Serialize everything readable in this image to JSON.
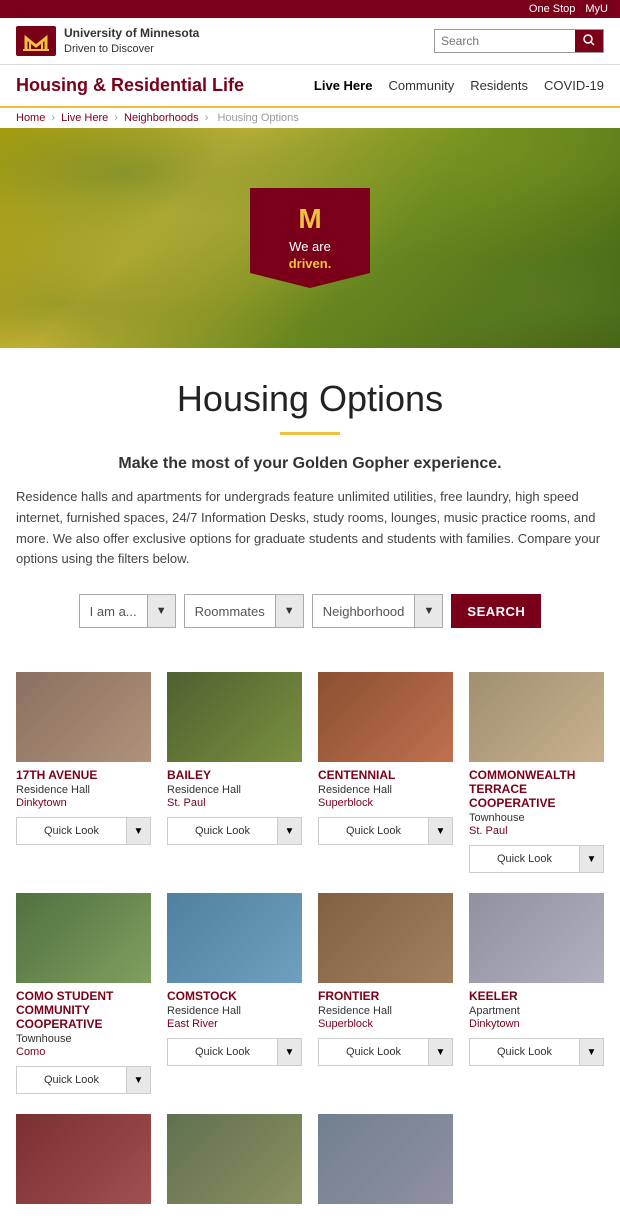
{
  "topbar": {
    "one_stop": "One Stop",
    "myu": "MyU"
  },
  "logo": {
    "line1": "University of Minnesota",
    "line2": "Driven to Discover"
  },
  "search": {
    "placeholder": "Search"
  },
  "nav": {
    "brand": "Housing & Residential Life",
    "links": [
      {
        "label": "Live Here",
        "active": true
      },
      {
        "label": "Community",
        "active": false
      },
      {
        "label": "Residents",
        "active": false
      },
      {
        "label": "COVID-19",
        "active": false
      }
    ]
  },
  "breadcrumb": {
    "items": [
      "Home",
      "Live Here",
      "Neighborhoods",
      "Housing Options"
    ]
  },
  "hero": {
    "flag_m": "M",
    "flag_line1": "We are",
    "flag_line2": "driven."
  },
  "page": {
    "title": "Housing Options",
    "subtitle": "Make the most of your Golden Gopher experience.",
    "description": "Residence halls and apartments for undergrads feature unlimited utilities, free laundry, high speed internet, furnished spaces, 24/7 Information Desks, study rooms, lounges, music practice rooms, and more. We also offer exclusive options for graduate students and students with families. Compare your options using the filters below."
  },
  "filters": {
    "role_placeholder": "I am a...",
    "roommates_placeholder": "Roommates",
    "neighborhood_placeholder": "Neighborhood",
    "search_label": "SEARCH"
  },
  "housing": [
    {
      "name": "17TH AVENUE",
      "type": "Residence Hall",
      "neighborhood": "Dinkytown",
      "img_class": "img-17th",
      "quick_look": "Quick Look"
    },
    {
      "name": "BAILEY",
      "type": "Residence Hall",
      "neighborhood": "St. Paul",
      "img_class": "img-bailey",
      "quick_look": "Quick Look"
    },
    {
      "name": "CENTENNIAL",
      "type": "Residence Hall",
      "neighborhood": "Superblock",
      "img_class": "img-centennial",
      "quick_look": "Quick Look"
    },
    {
      "name": "COMMONWEALTH TERRACE COOPERATIVE",
      "type": "Townhouse",
      "neighborhood": "St. Paul",
      "img_class": "img-commonwealth",
      "quick_look": "Quick Look"
    },
    {
      "name": "COMO STUDENT COMMUNITY COOPERATIVE",
      "type": "Townhouse",
      "neighborhood": "Como",
      "img_class": "img-como",
      "quick_look": "Quick Look"
    },
    {
      "name": "COMSTOCK",
      "type": "Residence Hall",
      "neighborhood": "East River",
      "img_class": "img-comstock",
      "quick_look": "Quick Look"
    },
    {
      "name": "FRONTIER",
      "type": "Residence Hall",
      "neighborhood": "Superblock",
      "img_class": "img-frontier",
      "quick_look": "Quick Look"
    },
    {
      "name": "KEELER",
      "type": "Apartment",
      "neighborhood": "Dinkytown",
      "img_class": "img-keeler",
      "quick_look": "Quick Look"
    },
    {
      "name": "",
      "type": "",
      "neighborhood": "",
      "img_class": "img-row4a",
      "quick_look": ""
    },
    {
      "name": "",
      "type": "",
      "neighborhood": "",
      "img_class": "img-row4b",
      "quick_look": ""
    },
    {
      "name": "",
      "type": "",
      "neighborhood": "",
      "img_class": "img-row4c",
      "quick_look": ""
    }
  ]
}
